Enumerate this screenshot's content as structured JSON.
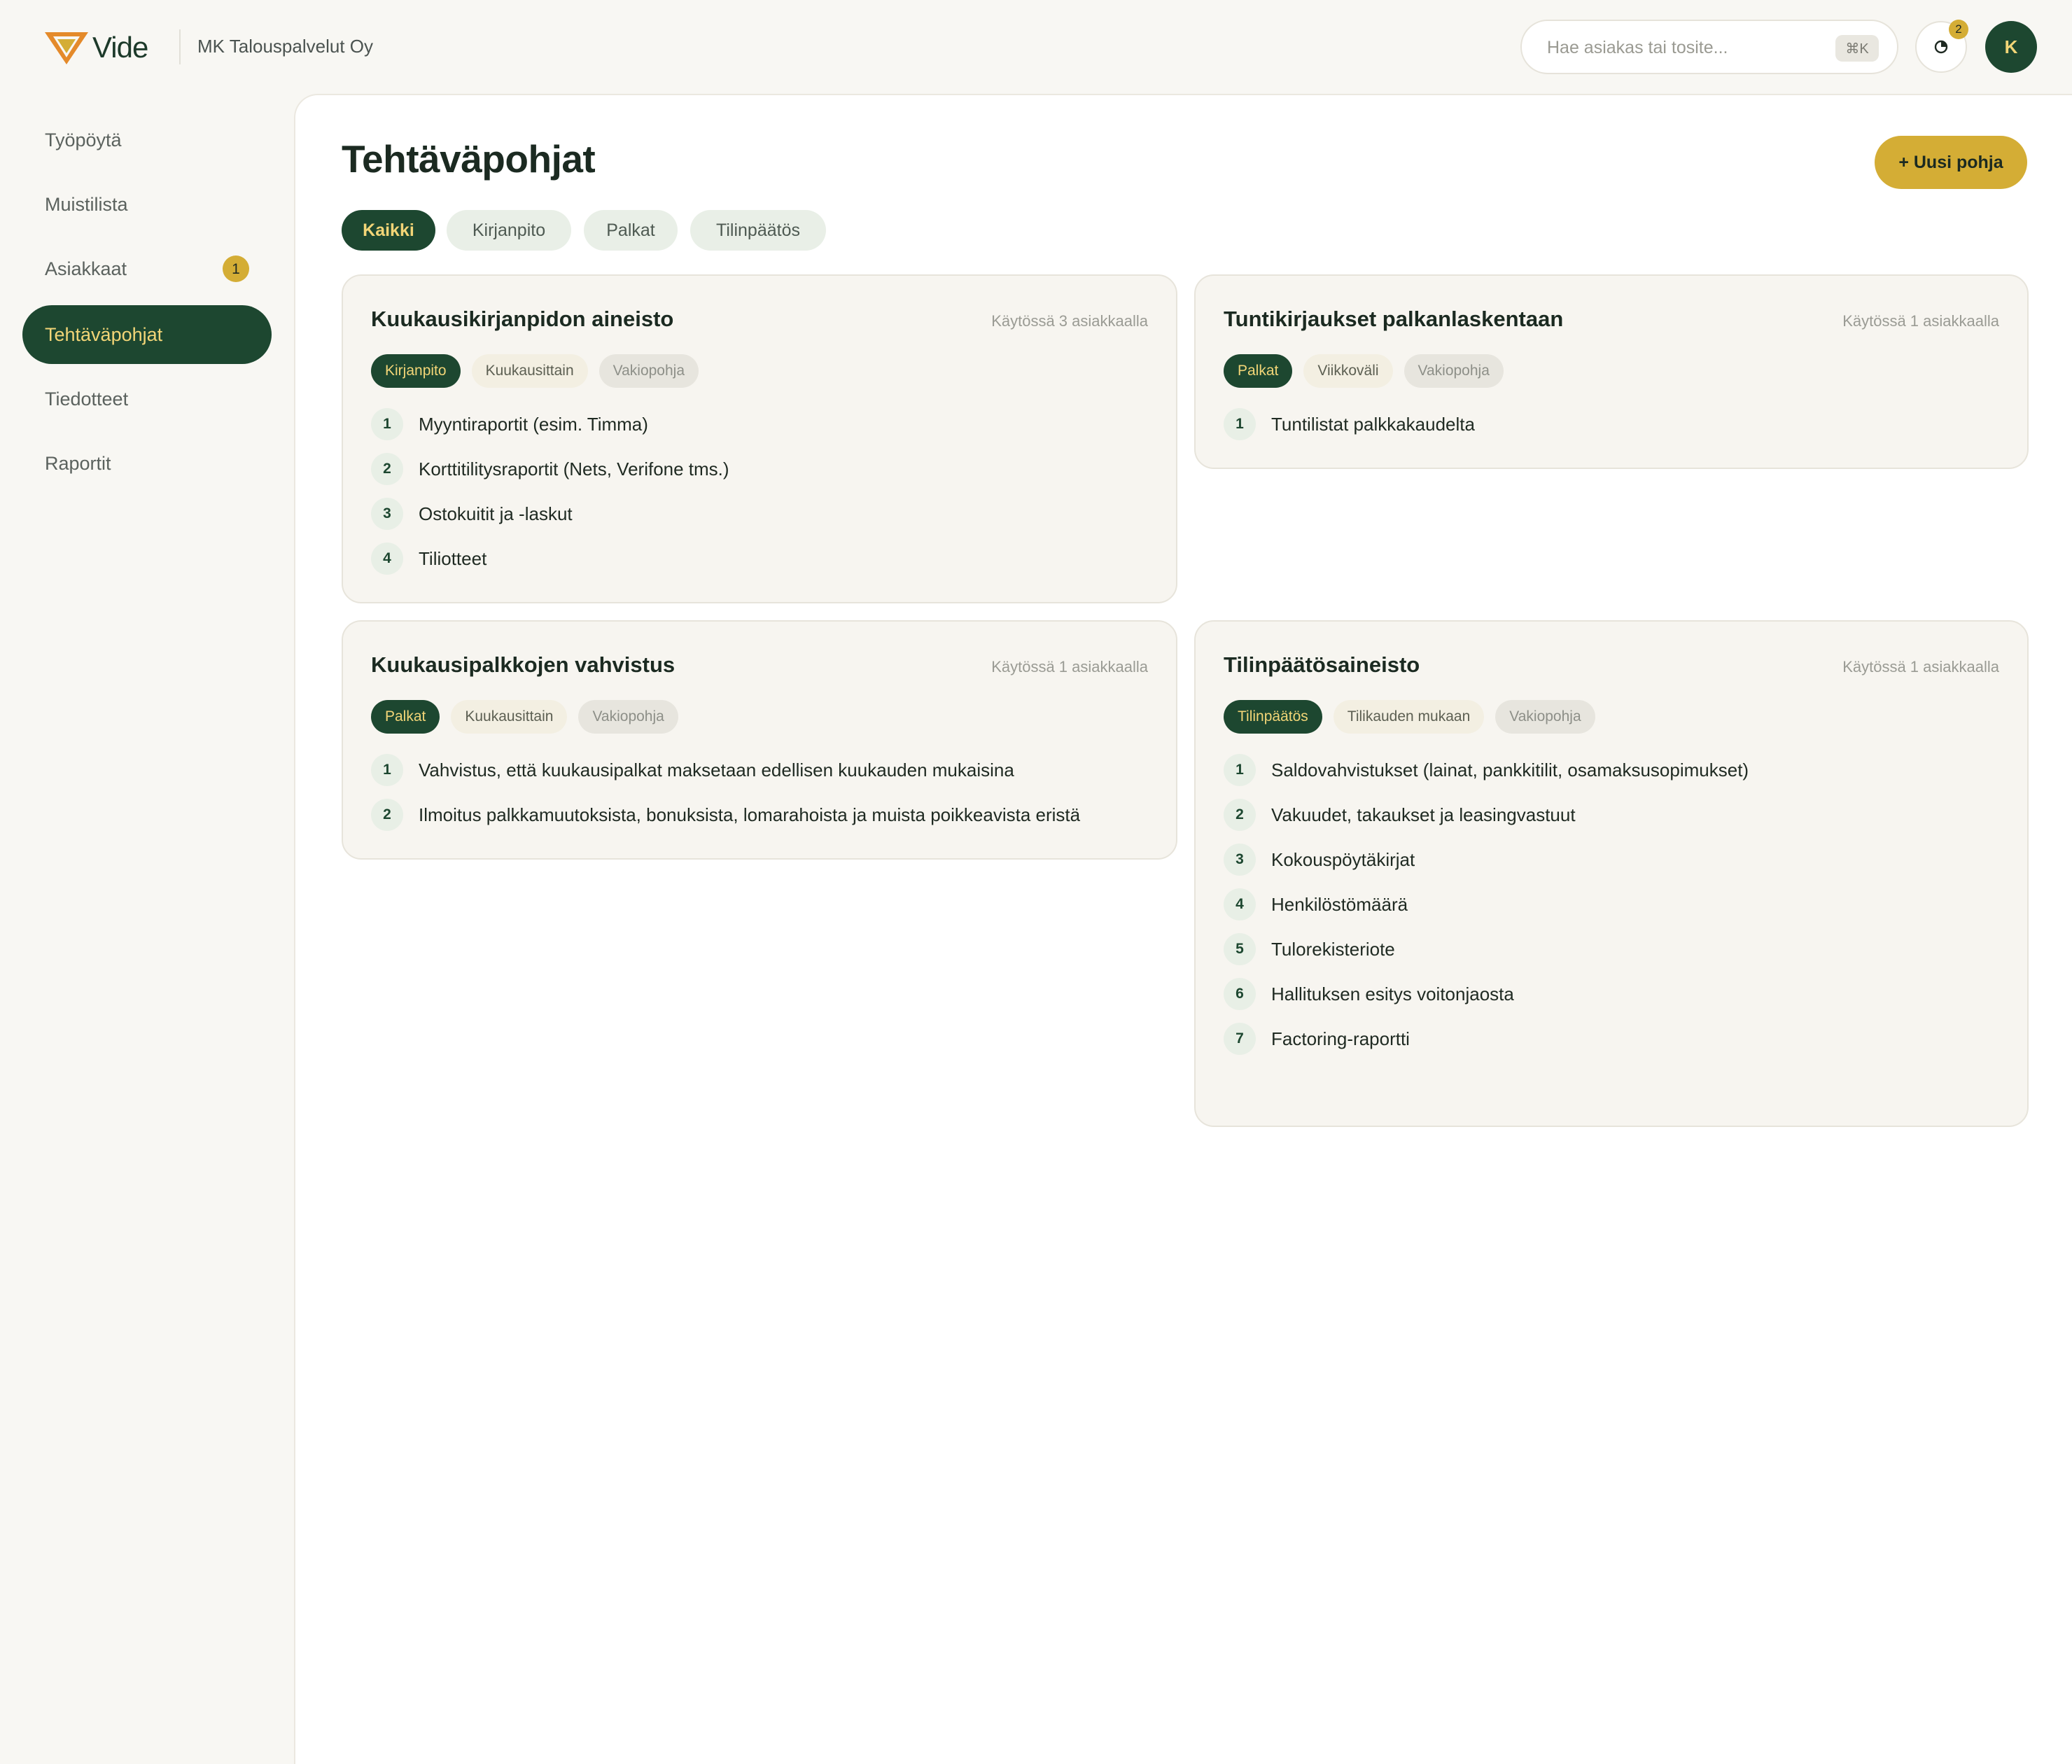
{
  "header": {
    "logo_text": "Vide",
    "org_name": "MK Talouspalvelut Oy",
    "search_placeholder": "Hae asiakas tai tosite...",
    "search_shortcut": "⌘K",
    "notifications_count": "2",
    "avatar_initial": "K"
  },
  "sidebar": {
    "items": [
      {
        "label": "Työpöytä"
      },
      {
        "label": "Muistilista"
      },
      {
        "label": "Asiakkaat",
        "badge": "1"
      },
      {
        "label": "Tehtäväpohjat",
        "active": true
      },
      {
        "label": "Tiedotteet"
      },
      {
        "label": "Raportit"
      }
    ]
  },
  "main": {
    "title": "Tehtäväpohjat",
    "new_button_label": "+ Uusi pohja",
    "filters": [
      "Kaikki",
      "Kirjanpito",
      "Palkat",
      "Tilinpäätös"
    ],
    "active_filter": "Kaikki"
  },
  "cards": [
    {
      "title": "Kuukausikirjanpidon aineisto",
      "usage": "Käytössä 3 asiakkaalla",
      "tags": {
        "category": "Kirjanpito",
        "frequency": "Kuukausittain",
        "type": "Vakiopohja"
      },
      "steps": [
        {
          "n": "1",
          "text": "Myyntiraportit (esim. Timma)"
        },
        {
          "n": "2",
          "text": "Korttitilitysraportit (Nets, Verifone tms.)"
        },
        {
          "n": "3",
          "text": "Ostokuitit ja -laskut"
        },
        {
          "n": "4",
          "text": "Tiliotteet"
        }
      ]
    },
    {
      "title": "Tuntikirjaukset palkanlaskentaan",
      "usage": "Käytössä 1 asiakkaalla",
      "tags": {
        "category": "Palkat",
        "frequency": "Viikkoväli",
        "type": "Vakiopohja"
      },
      "steps": [
        {
          "n": "1",
          "text": "Tuntilistat palkkakaudelta"
        }
      ]
    },
    {
      "title": "Kuukausipalkkojen vahvistus",
      "usage": "Käytössä 1 asiakkaalla",
      "tags": {
        "category": "Palkat",
        "frequency": "Kuukausittain",
        "type": "Vakiopohja"
      },
      "steps": [
        {
          "n": "1",
          "text": "Vahvistus, että kuukausipalkat maksetaan edellisen kuukauden mukaisina"
        },
        {
          "n": "2",
          "text": "Ilmoitus palkkamuutoksista, bonuksista, lomarahoista ja muista poikkeavista eristä"
        }
      ]
    },
    {
      "title": "Tilinpäätösaineisto",
      "usage": "Käytössä 1 asiakkaalla",
      "tags": {
        "category": "Tilinpäätös",
        "frequency": "Tilikauden mukaan",
        "type": "Vakiopohja"
      },
      "steps": [
        {
          "n": "1",
          "text": "Saldovahvistukset (lainat, pankkitilit, osamaksusopimukset)"
        },
        {
          "n": "2",
          "text": "Vakuudet, takaukset ja leasingvastuut"
        },
        {
          "n": "3",
          "text": "Kokouspöytäkirjat"
        },
        {
          "n": "4",
          "text": "Henkilöstömäärä"
        },
        {
          "n": "5",
          "text": "Tulorekisteriote"
        },
        {
          "n": "6",
          "text": "Hallituksen esitys voitonjaosta"
        },
        {
          "n": "7",
          "text": "Factoring-raportti"
        }
      ]
    }
  ],
  "colors": {
    "brand_green": "#1d4730",
    "accent_gold": "#d4ad35",
    "background": "#f8f7f3"
  }
}
